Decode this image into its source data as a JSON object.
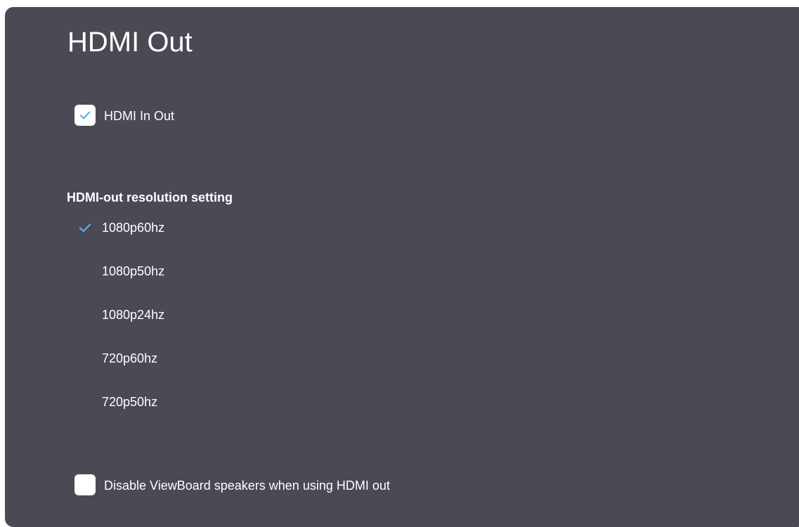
{
  "page": {
    "title": "HDMI Out"
  },
  "hdmi_in_out": {
    "label": "HDMI In Out",
    "checked": true
  },
  "resolution": {
    "heading": "HDMI-out resolution setting",
    "selected": "1080p60hz",
    "options": [
      "1080p60hz",
      "1080p50hz",
      "1080p24hz",
      "720p60hz",
      "720p50hz"
    ]
  },
  "disable_speakers": {
    "label": "Disable ViewBoard speakers when using HDMI out",
    "checked": false
  },
  "colors": {
    "panel_bg": "#4a4954",
    "accent_check": "#5ab4e5",
    "text": "#ffffff"
  },
  "icons": {
    "checkbox_check": "check-icon",
    "selected_mark": "check-icon"
  }
}
